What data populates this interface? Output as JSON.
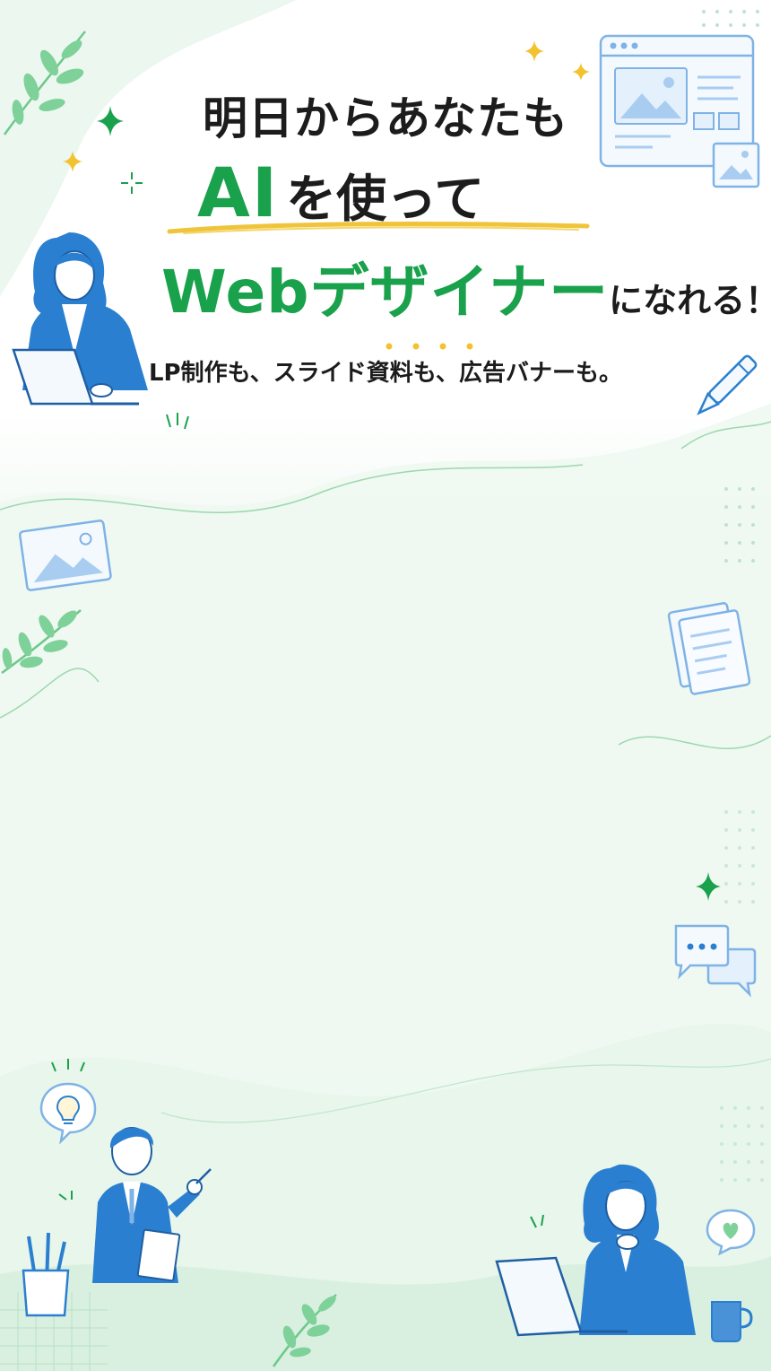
{
  "headline": {
    "line1": "明日からあなたも",
    "line2_accent": "AI",
    "line2_rest": "を使って",
    "line3_accent": "Webデザイナー",
    "line3_rest": "になれる！"
  },
  "subtitle": "LP制作も、スライド資料も、広告バナーも。",
  "colors": {
    "accent_green": "#1aa14c",
    "text_dark": "#1c1c1c",
    "illustration_blue": "#2b7fd0",
    "sparkle_yellow": "#f2c230",
    "underline_yellow": "#f0c43a"
  },
  "icons": [
    "leaf-icon",
    "sparkle-icon",
    "browser-window-icon",
    "image-icon",
    "pen-icon",
    "documents-icon",
    "chat-bubbles-icon",
    "lightbulb-icon",
    "heart-bubble-icon",
    "pencil-cup-icon",
    "mug-icon"
  ],
  "people": [
    "woman-with-laptop",
    "man-presenting",
    "woman-at-laptop"
  ]
}
